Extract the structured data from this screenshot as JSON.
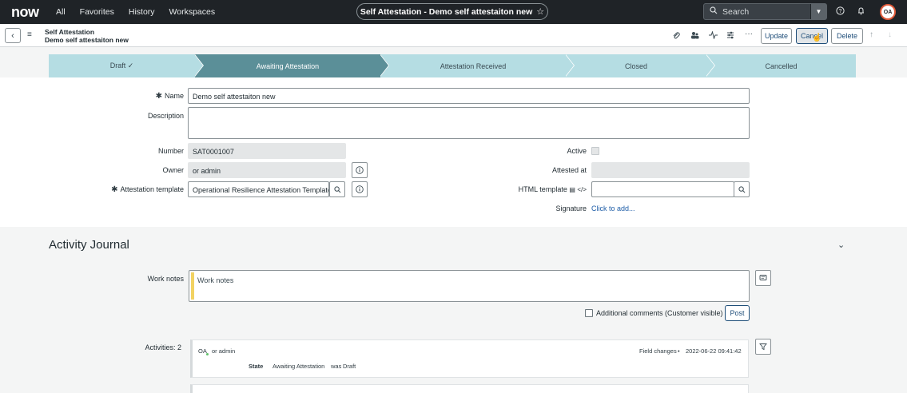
{
  "topnav": {
    "logo": "now",
    "links": [
      "All",
      "Favorites",
      "History",
      "Workspaces"
    ],
    "record_pill": "Self Attestation - Demo self attestaiton new",
    "star": "☆",
    "search_label": "Search",
    "avatar_initials": "OA"
  },
  "header": {
    "table_label": "Self Attestation",
    "record_name": "Demo self attestaiton new",
    "buttons": {
      "update": "Update",
      "cancel": "Cancel",
      "delete": "Delete"
    }
  },
  "stages": [
    {
      "label": "Draft ✓",
      "state": "complete"
    },
    {
      "label": "Awaiting Attestation",
      "state": "current"
    },
    {
      "label": "Attestation Received",
      "state": "pending"
    },
    {
      "label": "Closed",
      "state": "pending"
    },
    {
      "label": "Cancelled",
      "state": "pending"
    }
  ],
  "form": {
    "name": {
      "label": "Name",
      "value": "Demo self attestaiton new",
      "required": "✱"
    },
    "description": {
      "label": "Description",
      "value": ""
    },
    "number": {
      "label": "Number",
      "value": "SAT0001007"
    },
    "owner": {
      "label": "Owner",
      "value": "or admin"
    },
    "attestation_template": {
      "label": "Attestation template",
      "value": "Operational Resilience Attestation Template",
      "required": "✱"
    },
    "active": {
      "label": "Active"
    },
    "attested_at": {
      "label": "Attested at",
      "value": ""
    },
    "html_template": {
      "label": "HTML template",
      "value": ""
    },
    "signature": {
      "label": "Signature",
      "link": "Click to add..."
    }
  },
  "journal": {
    "title": "Activity Journal",
    "work_notes_label": "Work notes",
    "work_notes_placeholder": "Work notes",
    "additional_comments_label": "Additional comments (Customer visible)",
    "post_label": "Post",
    "activities_label": "Activities: 2",
    "entries": [
      {
        "avatar": "OA",
        "user": "or admin",
        "meta": "Field changes",
        "bullet": "•",
        "timestamp": "2022-06-22 09:41:42",
        "field": "State",
        "new_value": "Awaiting Attestation",
        "was": "was",
        "old_value": "Draft"
      }
    ]
  }
}
